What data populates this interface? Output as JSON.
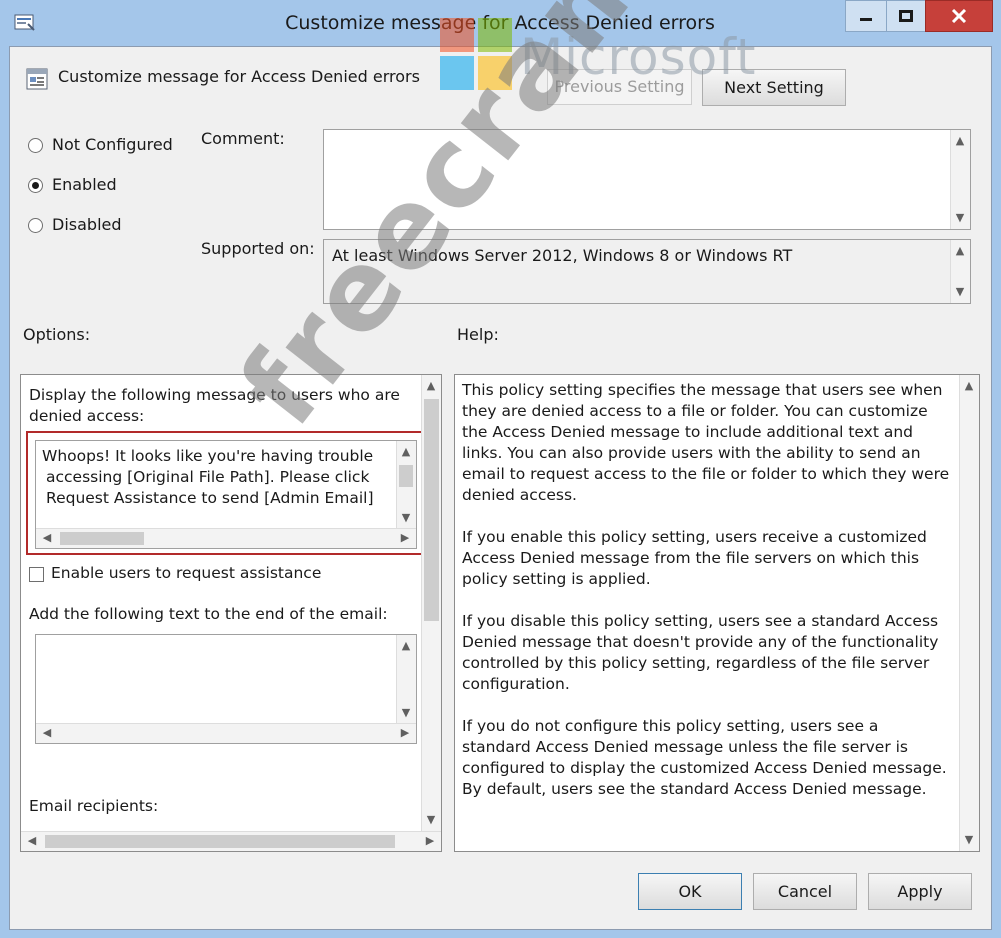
{
  "window": {
    "title": "Customize message for Access Denied errors"
  },
  "header": {
    "policy_name": "Customize message for Access Denied errors"
  },
  "nav": {
    "previous_label": "Previous Setting",
    "next_label": "Next Setting"
  },
  "state": {
    "options": [
      {
        "label": "Not Configured",
        "selected": false
      },
      {
        "label": "Enabled",
        "selected": true
      },
      {
        "label": "Disabled",
        "selected": false
      }
    ]
  },
  "comment": {
    "label": "Comment:",
    "value": ""
  },
  "supported": {
    "label": "Supported on:",
    "value": "At least Windows Server 2012, Windows 8 or Windows RT"
  },
  "options_panel": {
    "title": "Options:",
    "message_label_line1": "Display the following message to users who are",
    "message_label_line2": "denied access:",
    "message_lines": [
      "Whoops! It looks like you're having trouble",
      "accessing [Original File Path]. Please click",
      "Request Assistance to send [Admin Email]"
    ],
    "enable_assistance_label": "Enable users to request assistance",
    "enable_assistance_checked": false,
    "email_text_label": "Add the following text to the end of the email:",
    "email_recipients_label": "Email recipients:"
  },
  "help_panel": {
    "title": "Help:",
    "paragraphs": [
      "This policy setting specifies the message that users see when they are denied access to a file or folder. You can customize the Access Denied message to include additional text and links. You can also provide users with the ability to send an email to request access to the file or folder to which they were denied access.",
      "If you enable this policy setting, users receive a customized Access Denied message from the file servers on which this policy setting is applied.",
      "If you disable this policy setting, users see a standard Access Denied message that doesn't provide any of the functionality controlled by this policy setting, regardless of the file server configuration.",
      "If you do not configure this policy setting, users see a standard Access Denied message unless the file server is configured to display the customized Access Denied message. By default, users see the standard Access Denied message."
    ]
  },
  "footer": {
    "ok_label": "OK",
    "cancel_label": "Cancel",
    "apply_label": "Apply"
  },
  "watermarks": {
    "logo_text": "Microsoft",
    "diagonal_text": "freecram.net"
  },
  "colors": {
    "title_bar": "#a4c6ea",
    "close_button": "#c6403a",
    "highlight_border": "#b22a2a"
  }
}
